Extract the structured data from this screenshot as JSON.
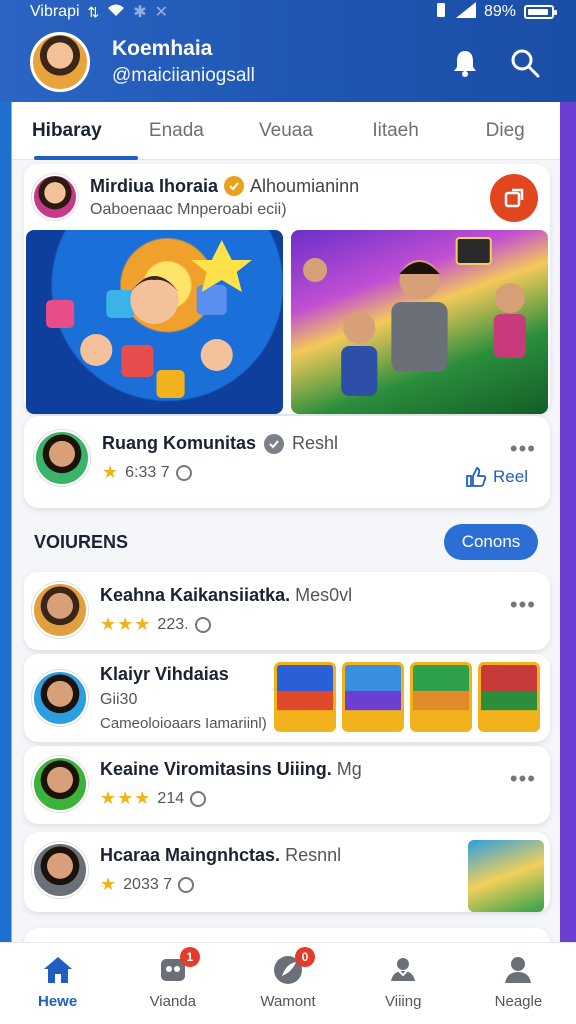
{
  "status_bar": {
    "carrier": "Vibrapi",
    "battery_percent": "89%",
    "battery_level": 0.89
  },
  "profile": {
    "name": "Koemhaia",
    "handle": "@maiciianiogsall"
  },
  "tabs": [
    {
      "label": "Hibaray"
    },
    {
      "label": "Enada"
    },
    {
      "label": "Veuaa"
    },
    {
      "label": "Iitaeh"
    },
    {
      "label": "Dieg"
    }
  ],
  "post": {
    "author": "Mirdiua Ihoraia",
    "author_suffix": "Alhoumianinn",
    "subtitle": "Oaboenaac Mnperoabi ecii)"
  },
  "community": {
    "title": "Ruang Komunitas",
    "tag": "Reshl",
    "rating_text": "6:33 7",
    "like_label": "Reel"
  },
  "section": {
    "title": "VOIURENS",
    "button_label": "Conons"
  },
  "items": [
    {
      "title": "Keahna Kaikansiiatka.",
      "tag": "Mes0vl",
      "rating_text": "223.",
      "stars": "★★★"
    },
    {
      "title": "Klaiyr Vihdaias",
      "sub1": "Gii30",
      "sub2": "Cameoloioaars Iamariinl)"
    },
    {
      "title": "Keaine Viromitasins Uiiing.",
      "tag": "Mg",
      "rating_text": "214",
      "stars": "★★★"
    },
    {
      "title": "Hcaraa Maingnhctas.",
      "tag": "Resnnl",
      "rating_text": "2033 7",
      "stars": "★"
    }
  ],
  "bottom_nav": [
    {
      "label": "Hewe"
    },
    {
      "label": "Vianda",
      "badge": "1"
    },
    {
      "label": "Wamont",
      "badge": "0"
    },
    {
      "label": "Viiing"
    },
    {
      "label": "Neagle"
    }
  ],
  "colors": {
    "primary": "#1f56b3",
    "accent": "#2b6fd6",
    "danger": "#e53b2c",
    "star": "#f2b21c"
  }
}
